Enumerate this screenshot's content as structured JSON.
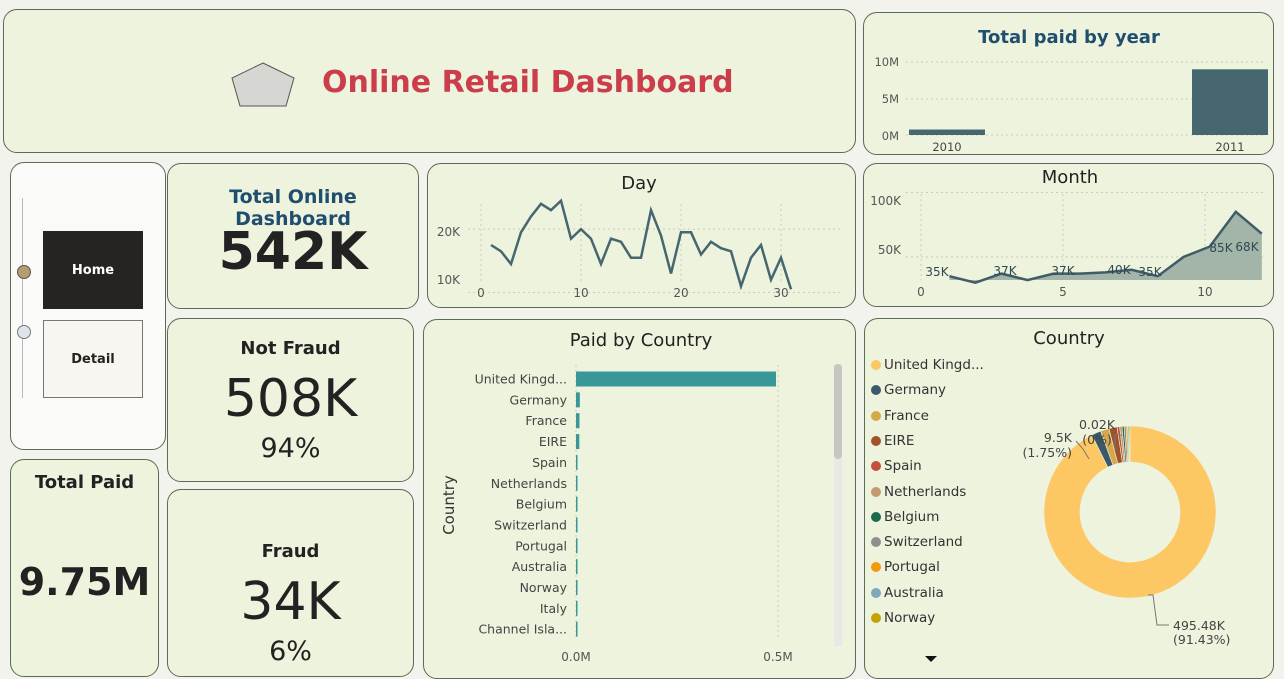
{
  "header": {
    "title": "Online Retail Dashboard"
  },
  "nav": {
    "home_label": "Home",
    "detail_label": "Detail"
  },
  "kpi_total": {
    "label": "Total Online Dashboard",
    "value": "542K"
  },
  "kpi_not_fraud": {
    "label": "Not Fraud",
    "value": "508K",
    "pct": "94%"
  },
  "kpi_fraud": {
    "label": "Fraud",
    "value": "34K",
    "pct": "6%"
  },
  "kpi_paid": {
    "label": "Total Paid",
    "value": "9.75M"
  },
  "colors": {
    "title": "#cc3d4b",
    "navy": "#1f4e6e",
    "line": "#466670",
    "bar_teal": "#3a9797",
    "donut_main": "#fdc764",
    "card_bg": "#eef3dd"
  },
  "chart_data": [
    {
      "id": "year",
      "type": "bar",
      "title": "Total paid by year",
      "categories": [
        "2010",
        "2011"
      ],
      "values": [
        0.75,
        9.0
      ],
      "value_unit": "M",
      "yticks": [
        "0M",
        "5M",
        "10M"
      ],
      "ylim": [
        0,
        10
      ]
    },
    {
      "id": "day",
      "type": "line",
      "title": "Day",
      "x": [
        1,
        2,
        3,
        4,
        5,
        6,
        7,
        8,
        9,
        10,
        11,
        12,
        13,
        14,
        15,
        16,
        17,
        18,
        19,
        20,
        21,
        22,
        23,
        24,
        25,
        26,
        27,
        28,
        29,
        30,
        31
      ],
      "y": [
        17.5,
        16.5,
        14.5,
        19.5,
        22,
        24,
        23,
        24.5,
        18.5,
        20,
        18.5,
        14.5,
        18.5,
        18,
        15.5,
        15.5,
        23,
        19,
        13,
        19.5,
        19.5,
        16,
        18,
        17,
        16.5,
        11,
        15.5,
        17.5,
        12,
        15.5,
        10.5
      ],
      "xticks": [
        "0",
        "10",
        "20",
        "30"
      ],
      "yticks": [
        "10K",
        "20K"
      ],
      "xlim": [
        0,
        35
      ],
      "ylim": [
        8.5,
        26.5
      ],
      "grid": true
    },
    {
      "id": "month",
      "type": "area",
      "title": "Month",
      "x": [
        1,
        2,
        3,
        4,
        5,
        6,
        7,
        8,
        9,
        10,
        11,
        12
      ],
      "y": [
        35,
        30,
        37,
        32,
        37,
        37,
        38,
        40,
        35,
        50,
        58,
        85,
        68
      ],
      "y_note": "monthly values in thousands",
      "data_labels": [
        {
          "x": 1,
          "text": "35K"
        },
        {
          "x": 3,
          "text": "37K"
        },
        {
          "x": 5,
          "text": "37K"
        },
        {
          "x": 8,
          "text": "40K"
        },
        {
          "x": 9,
          "text": "35K"
        },
        {
          "x": 11,
          "text": "85K"
        },
        {
          "x": 12,
          "text": "68K"
        }
      ],
      "xticks": [
        "0",
        "5",
        "10"
      ],
      "yticks": [
        "50K",
        "100K"
      ],
      "xlim": [
        0,
        12.5
      ],
      "ylim": [
        15,
        105
      ]
    },
    {
      "id": "country_bar",
      "type": "bar",
      "orientation": "horizontal",
      "title": "Paid by Country",
      "ylabel": "Country",
      "categories": [
        "United Kingd...",
        "Germany",
        "France",
        "EIRE",
        "Spain",
        "Netherlands",
        "Belgium",
        "Switzerland",
        "Portugal",
        "Australia",
        "Norway",
        "Italy",
        "Channel Isla..."
      ],
      "values": [
        0.495,
        0.0095,
        0.0086,
        0.0082,
        0.0025,
        0.0024,
        0.0021,
        0.002,
        0.0015,
        0.0013,
        0.0011,
        0.0008,
        0.0008
      ],
      "xticks": [
        "0.0M",
        "0.5M"
      ],
      "xlim": [
        0,
        0.5
      ]
    },
    {
      "id": "country_donut",
      "type": "pie",
      "title": "Country",
      "legend": [
        "United Kingd...",
        "Germany",
        "France",
        "EIRE",
        "Spain",
        "Netherlands",
        "Belgium",
        "Switzerland",
        "Portugal",
        "Australia",
        "Norway"
      ],
      "legend_colors": [
        "#fdc764",
        "#3a5a6a",
        "#d5a94a",
        "#a0522d",
        "#c0533a",
        "#c49a6c",
        "#1d6a4e",
        "#8e8e8e",
        "#f29a0e",
        "#7fa8b8",
        "#c2a400"
      ],
      "values": [
        495.48,
        9.5,
        8.56,
        8.2,
        2.53,
        2.37,
        2.07,
        2.0,
        1.52,
        1.26,
        1.09
      ],
      "data_labels": [
        {
          "text": "495.48K",
          "sub": "(91.43%)"
        },
        {
          "text": "9.5K",
          "sub": "(1.75%)"
        },
        {
          "text": "0.02K",
          "sub": "(0%)"
        }
      ]
    }
  ]
}
